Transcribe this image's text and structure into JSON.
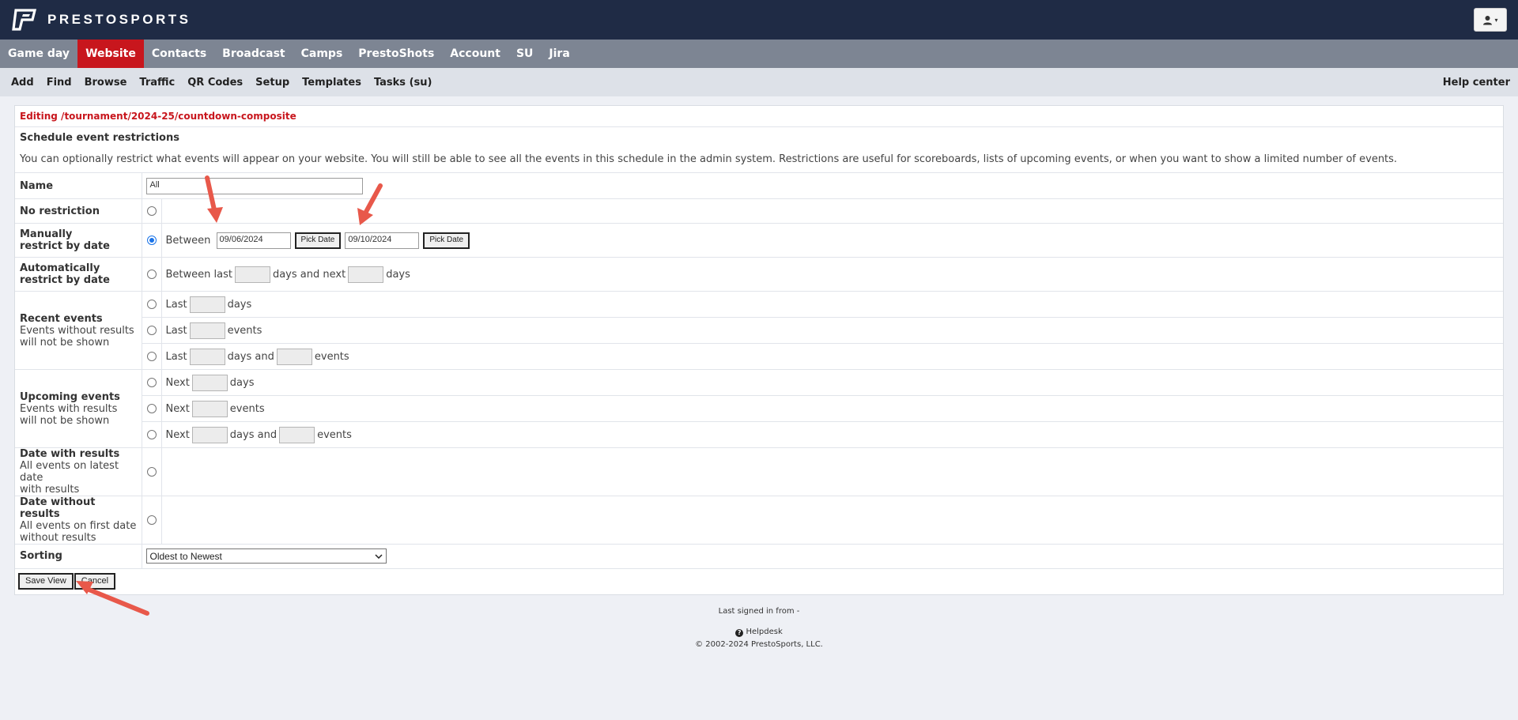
{
  "brand": {
    "name": "PRESTOSPORTS"
  },
  "user_menu": {
    "icon": "user-icon"
  },
  "main_nav": [
    "Game day",
    "Website",
    "Contacts",
    "Broadcast",
    "Camps",
    "PrestoShots",
    "Account",
    "SU",
    "Jira"
  ],
  "main_nav_active": "Website",
  "sub_nav": [
    "Add",
    "Find",
    "Browse",
    "Traffic",
    "QR Codes",
    "Setup",
    "Templates",
    "Tasks (su)"
  ],
  "help_center": "Help center",
  "panel": {
    "editing": "Editing /tournament/2024-25/countdown-composite",
    "title": "Schedule event restrictions",
    "description": "You can optionally restrict what events will appear on your website. You will still be able to see all the events in this schedule in the admin system. Restrictions are useful for scoreboards, lists of upcoming events, or when you want to show a limited number of events."
  },
  "form": {
    "name_label": "Name",
    "name_value": "All",
    "no_restriction": "No restriction",
    "manual_label_1": "Manually",
    "manual_label_2": "restrict by date",
    "between": "Between",
    "start_date": "09/06/2024",
    "end_date": "09/10/2024",
    "pick_date": "Pick Date",
    "auto_label_1": "Automatically",
    "auto_label_2": "restrict by date",
    "between_last": "Between last",
    "days_and_next": "days and next",
    "days": "days",
    "events": "events",
    "days_and": "days and",
    "last": "Last",
    "next": "Next",
    "recent_title": "Recent events",
    "recent_sub_1": "Events without results",
    "recent_sub_2": "will not be shown",
    "upcoming_title": "Upcoming events",
    "upcoming_sub_1": "Events with results",
    "upcoming_sub_2": "will not be shown",
    "dwr_title": "Date with results",
    "dwr_sub_1": "All events on latest date",
    "dwr_sub_2": "with results",
    "dwor_title": "Date without results",
    "dwor_sub_1": "All events on first date",
    "dwor_sub_2": "without results",
    "sorting_label": "Sorting",
    "sorting_value": "Oldest to Newest",
    "selected_option": "manual",
    "save": "Save View",
    "cancel": "Cancel"
  },
  "footer": {
    "last_signed": "Last signed in from -",
    "helpdesk": "Helpdesk",
    "copyright": "© 2002-2024 PrestoSports, LLC."
  },
  "colors": {
    "topbar": "#1f2b45",
    "nav": "#7d8593",
    "active": "#c8161d",
    "arrow": "#e8584a"
  }
}
